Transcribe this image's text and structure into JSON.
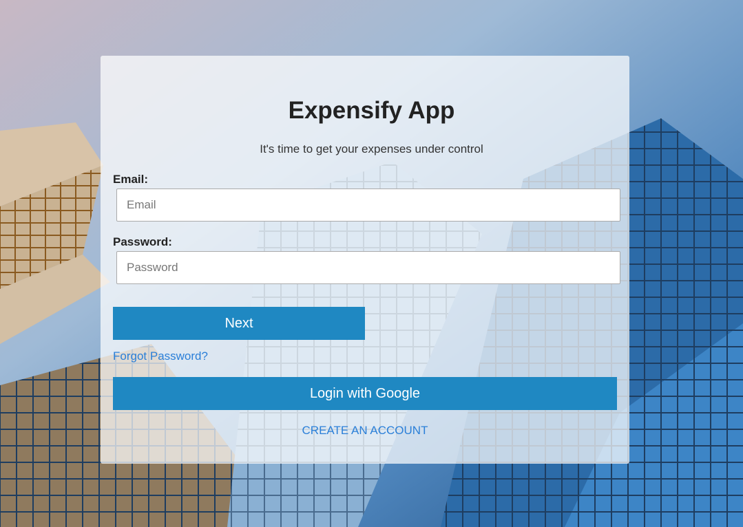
{
  "app": {
    "title": "Expensify App",
    "subtitle": "It's time to get your expenses under control"
  },
  "form": {
    "email_label": "Email:",
    "email_placeholder": "Email",
    "email_value": "",
    "password_label": "Password:",
    "password_placeholder": "Password",
    "password_value": "",
    "next_label": "Next",
    "forgot_label": "Forgot Password?",
    "google_label": "Login with Google",
    "create_label": "CREATE AN ACCOUNT"
  },
  "colors": {
    "button": "#1f88c2",
    "link": "#2a7fd8"
  }
}
